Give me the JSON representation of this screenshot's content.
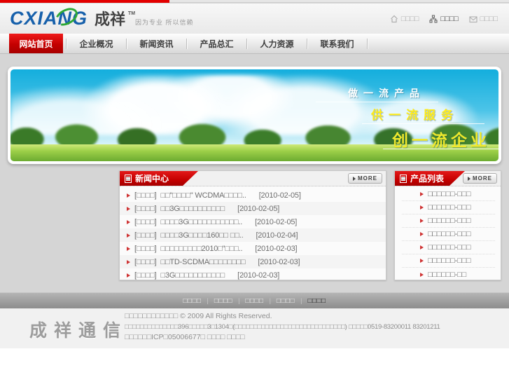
{
  "header": {
    "logo": {
      "latin": "CXIANG",
      "cn": "成祥",
      "tm": "TM",
      "tagline": "因为专业 所以信赖"
    },
    "top_links": [
      {
        "label": "□□□□",
        "icon": "home-icon"
      },
      {
        "label": "□□□□",
        "icon": "sitemap-icon"
      },
      {
        "label": "□□□□",
        "icon": "mail-icon"
      }
    ]
  },
  "nav": {
    "items": [
      {
        "label": "网站首页",
        "active": true
      },
      {
        "label": "企业概况",
        "active": false
      },
      {
        "label": "新闻资讯",
        "active": false
      },
      {
        "label": "产品总汇",
        "active": false
      },
      {
        "label": "人力资源",
        "active": false
      },
      {
        "label": "联系我们",
        "active": false
      }
    ]
  },
  "banner": {
    "slogan1": "做一流产品",
    "slogan2": "供一流服务",
    "slogan3": "创一流企业"
  },
  "news": {
    "title": "新闻中心",
    "more_label": "MORE",
    "items": [
      {
        "category": "[□□□□]",
        "text": "□□\"□□□□\" WCDMA□□□□..",
        "date": "[2010-02-05]"
      },
      {
        "category": "[□□□□]",
        "text": "□□3G□□□□□□□□□□",
        "date": "[2010-02-05]"
      },
      {
        "category": "[□□□□]",
        "text": "□□□□3G□□□□□□□□□□□..",
        "date": "[2010-02-05]"
      },
      {
        "category": "[□□□□]",
        "text": "□□□□3G□□□□160□□ □□..",
        "date": "[2010-02-04]"
      },
      {
        "category": "[□□□□]",
        "text": "□□□□□□□□□2010□\"□□□..",
        "date": "[2010-02-03]"
      },
      {
        "category": "[□□□□]",
        "text": "□□TD-SCDMA□□□□□□□□",
        "date": "[2010-02-03]"
      },
      {
        "category": "[□□□□]",
        "text": "□3G□□□□□□□□□□□",
        "date": "[2010-02-03]"
      }
    ]
  },
  "products": {
    "title": "产品列表",
    "more_label": "MORE",
    "items": [
      "□□□□□□-□□□",
      "□□□□□□-□□□",
      "□□□□□□-□□□",
      "□□□□□□-□□□",
      "□□□□□□-□□□",
      "□□□□□□-□□□",
      "□□□□□□-□□"
    ]
  },
  "footer": {
    "links": [
      "□□□□",
      "□□□□",
      "□□□□",
      "□□□□",
      "□□□□"
    ],
    "logo": "成祥通信",
    "line1": "□□□□□□□□□□□□ © 2009 All Rights Reserved.",
    "line2": "□□□□□□□□□□□□□□396□□□□□3□1304□(□□□□□□□□□□□□□□□□□□□□□□□□□□□□□)  □□□□□0519-83200011 83201211",
    "line3": "□□□□□□ICP□05006677□ □□□□ □□□□"
  }
}
